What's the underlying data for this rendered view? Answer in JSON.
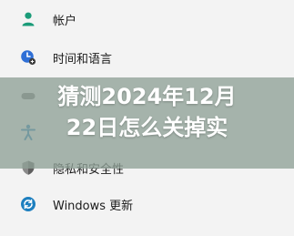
{
  "settings_menu": {
    "items": [
      {
        "label": "帐户",
        "icon": "account-icon",
        "color": "#1a9b78"
      },
      {
        "label": "时间和语言",
        "icon": "time-language-icon",
        "color": "#2f6fd6"
      },
      {
        "label": "",
        "icon": "gaming-icon",
        "color": "#7a7a7a"
      },
      {
        "label": "",
        "icon": "accessibility-icon",
        "color": "#1d7fbf"
      },
      {
        "label": "隐私和安全性",
        "icon": "shield-icon",
        "color": "#6f6f6f"
      },
      {
        "label": "Windows 更新",
        "icon": "windows-update-icon",
        "color": "#1d7fbf"
      }
    ]
  },
  "overlay": {
    "title_line1": "猜测2024年12月",
    "title_line2": "22日怎么关掉实"
  }
}
